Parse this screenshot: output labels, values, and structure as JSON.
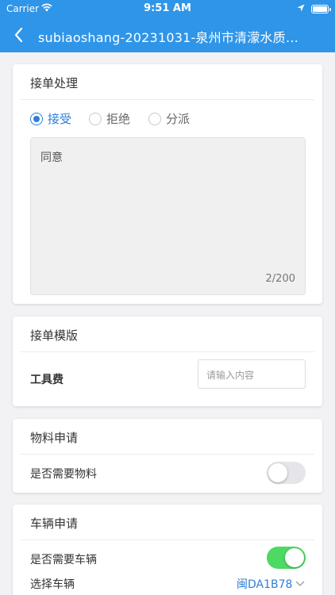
{
  "status_bar": {
    "carrier": "Carrier",
    "time": "9:51 AM"
  },
  "nav": {
    "title": "subiaoshang-20231031-泉州市清濛水质…"
  },
  "order_handling": {
    "title": "接单处理",
    "options": [
      "接受",
      "拒绝",
      "分派"
    ],
    "selected": "接受",
    "comment": "同意",
    "char_count": "2/200"
  },
  "template": {
    "title": "接单模版",
    "field_label": "工具费",
    "field_placeholder": "请输入内容"
  },
  "material": {
    "title": "物料申请",
    "need_label": "是否需要物料",
    "need_on": false
  },
  "vehicle": {
    "title": "车辆申请",
    "need_label": "是否需要车辆",
    "need_on": true,
    "select_label": "选择车辆",
    "select_value": "闽DA1B78"
  },
  "colors": {
    "accent": "#2f95e8",
    "toggle_on": "#4cd964",
    "link": "#2f7fd8"
  }
}
